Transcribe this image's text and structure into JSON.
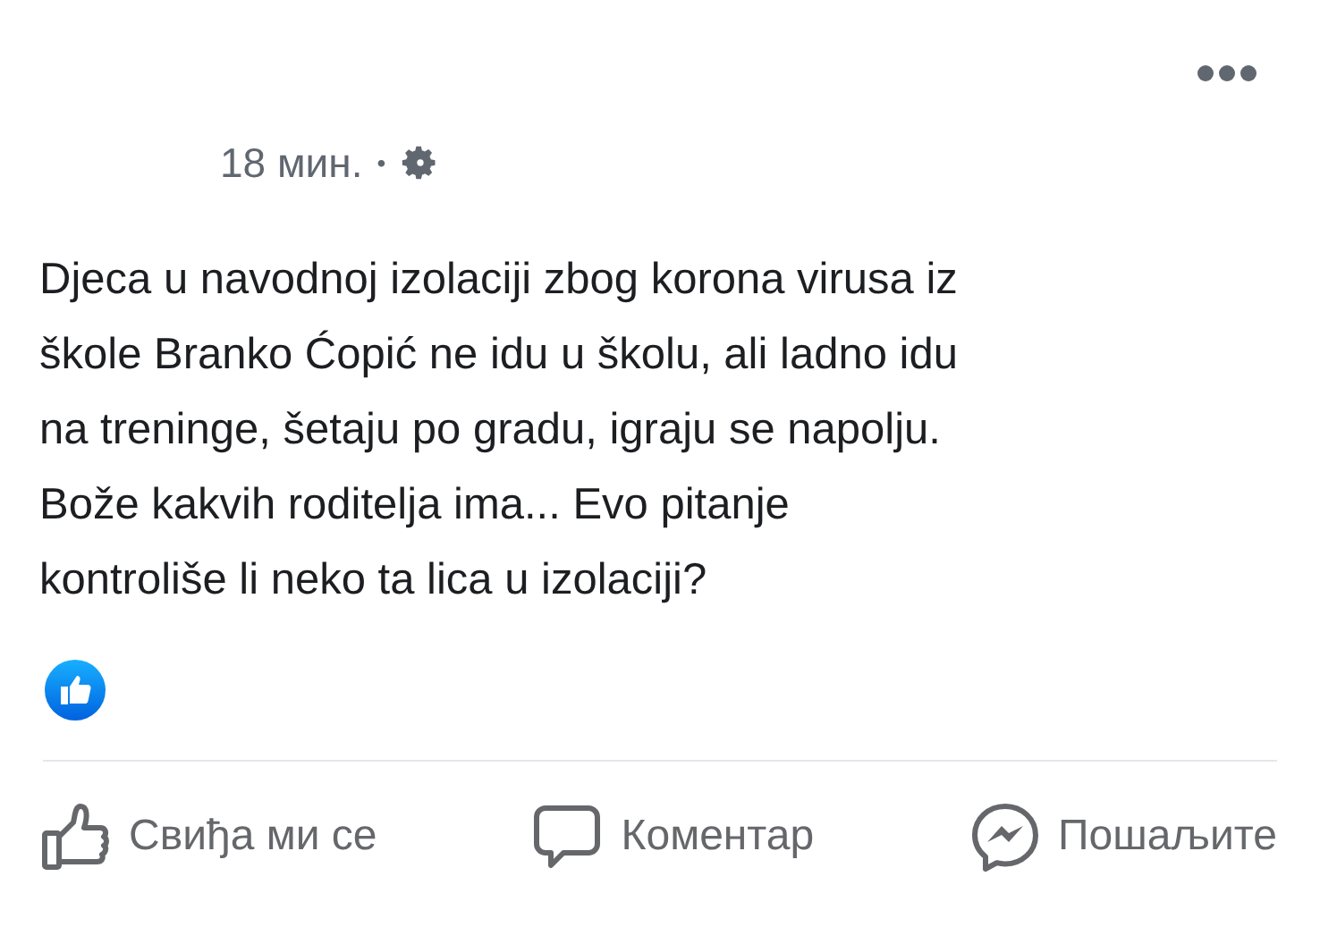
{
  "post": {
    "time": "18 мин.",
    "separator": "•",
    "text_lines": [
      "Djeca u navodnoj izolaciji zbog korona virusa iz",
      "škole Branko Ćopić ne idu u školu, ali ladno idu",
      "na treninge, šetaju po gradu, igraju se napolju.",
      "Bože kakvih roditelja ima... Evo pitanje",
      "kontroliše li neko ta lica u izolaciji?"
    ]
  },
  "actions": [
    {
      "kind": "like",
      "label": "Свиђа ми се"
    },
    {
      "kind": "comment",
      "label": "Коментар"
    },
    {
      "kind": "share",
      "label": "Пошаљите"
    }
  ]
}
